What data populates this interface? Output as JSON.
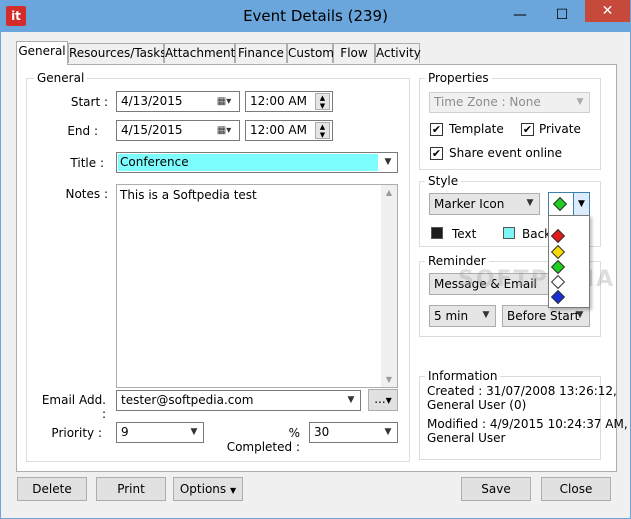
{
  "window": {
    "title": "Event Details (239)",
    "app_icon": "it",
    "min_glyph": "—",
    "max_glyph": "☐",
    "close_glyph": "✕"
  },
  "tabs": [
    "General",
    "Resources/Tasks",
    "Attachments",
    "Finance",
    "Custom",
    "Flow",
    "Activity"
  ],
  "general": {
    "group_title": "General",
    "start_label": "Start :",
    "start_date": "4/13/2015",
    "start_time": "12:00 AM",
    "end_label": "End :",
    "end_date": "4/15/2015",
    "end_time": "12:00 AM",
    "title_label": "Title :",
    "title_value": "Conference",
    "notes_label": "Notes :",
    "notes_value": "This is a Softpedia test",
    "email_label": "Email Add. :",
    "email_value": "tester@softpedia.com",
    "email_btn": "...",
    "priority_label": "Priority :",
    "priority_value": "9",
    "completed_label": "% Completed :",
    "completed_value": "30"
  },
  "properties": {
    "group_title": "Properties",
    "timezone": "Time Zone : None",
    "template": "Template",
    "private": "Private",
    "share": "Share event online"
  },
  "style": {
    "group_title": "Style",
    "marker": "Marker Icon",
    "text_label": "Text",
    "background_label": "Backg",
    "selected_color": "#1fcf1f",
    "dropdown_colors": [
      "#e21b1b",
      "#f5d90a",
      "#1fcf1f",
      "#ffffff",
      "#1a2fd6"
    ]
  },
  "reminder": {
    "group_title": "Reminder",
    "method": "Message & Email",
    "interval": "5 min",
    "when": "Before Start"
  },
  "information": {
    "group_title": "Information",
    "created_line1": "Created : 31/07/2008 13:26:12,",
    "created_line2": "General User (0)",
    "modified_line1": "Modified : 4/9/2015 10:24:37 AM,",
    "modified_line2": "General User"
  },
  "buttons": {
    "delete": "Delete",
    "print": "Print",
    "options": "Options",
    "save": "Save",
    "close": "Close"
  },
  "watermark": "SOFTPEDIA"
}
